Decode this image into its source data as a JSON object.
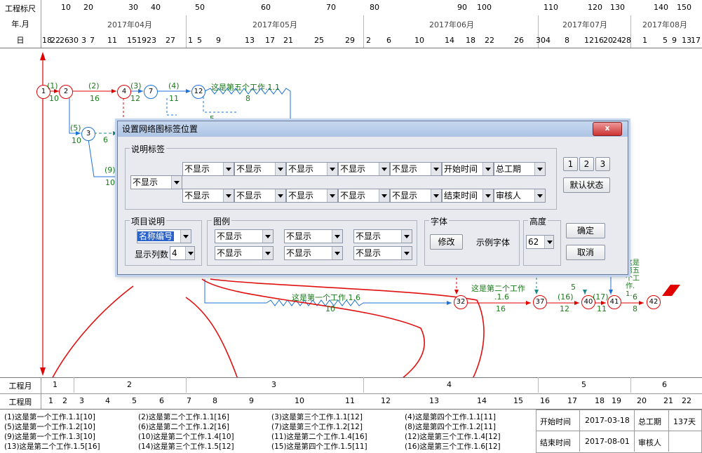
{
  "header": {
    "scale_label": "工程标尺",
    "month_label": "年.月",
    "day_label": "日",
    "scale_ticks": [
      "10",
      "20",
      "30",
      "40",
      "50",
      "60",
      "70",
      "80",
      "90",
      "100",
      "110",
      "120",
      "130",
      "140",
      "150"
    ],
    "months": [
      "2017年04月",
      "2017年05月",
      "2017年06月",
      "2017年07月",
      "2017年08月"
    ],
    "days": [
      "18",
      "22",
      "26",
      "30",
      "3",
      "7",
      "11",
      "15",
      "19",
      "23",
      "27",
      "1",
      "5",
      "9",
      "13",
      "17",
      "21",
      "25",
      "29",
      "2",
      "6",
      "10",
      "14",
      "18",
      "22",
      "26",
      "30",
      "4",
      "8",
      "12",
      "16",
      "20",
      "24",
      "28",
      "1",
      "5",
      "9",
      "13",
      "17"
    ]
  },
  "network": {
    "nodes": [
      "1",
      "2",
      "4",
      "7",
      "12",
      "3",
      "32",
      "37",
      "40",
      "41",
      "42"
    ],
    "labels": {
      "a1": "(1)",
      "d1": "10",
      "a2": "(2)",
      "d2": "16",
      "a3": "(3)",
      "d3": "12",
      "a4": "(4)",
      "d4": "11",
      "w5": "这是第五个工作.1.1",
      "d5": "8",
      "a5": "(5)",
      "d5b": "10",
      "d6": "6",
      "a9": "(9)",
      "d9": "10",
      "w5b": "5",
      "w_first": "这是第一个工作.1.6",
      "d_first": "10",
      "w_second": "这是第二个工作",
      "w_second2": ".1.6",
      "d32": "16",
      "a16": "(16)",
      "d37": "12",
      "w5c": "5",
      "a17": "(17)",
      "d40": "11",
      "d41": "6",
      "d41b": "8",
      "w5v": "这是第五个工作.1."
    }
  },
  "dialog": {
    "title": "设置网络图标签位置",
    "close": "x",
    "explain_group": "说明标签",
    "row1": [
      "不显示",
      "不显示",
      "不显示",
      "不显示",
      "不显示",
      "开始时间",
      "总工期"
    ],
    "row_mid": "不显示",
    "row2": [
      "不显示",
      "不显示",
      "不显示",
      "不显示",
      "不显示",
      "结束时间",
      "审核人"
    ],
    "pos_buttons": [
      "1",
      "2",
      "3"
    ],
    "default_btn": "默认状态",
    "project_group": "项目说明",
    "project_select": "名称编号",
    "cols_label": "显示列数",
    "cols_value": "4",
    "legend_group": "图例",
    "legend_row1": [
      "不显示",
      "不显示",
      "不显示"
    ],
    "legend_row2": [
      "不显示",
      "不显示",
      "不显示"
    ],
    "font_group": "字体",
    "font_btn": "修改",
    "font_sample": "示例字体",
    "height_group": "高度",
    "height_value": "62",
    "ok": "确定",
    "cancel": "取消"
  },
  "footer": {
    "month_label": "工程月",
    "months": [
      "1",
      "2",
      "3",
      "4",
      "5",
      "6"
    ],
    "week_label": "工程周",
    "weeks": [
      "1",
      "2",
      "3",
      "4",
      "5",
      "6",
      "7",
      "8",
      "9",
      "10",
      "11",
      "12",
      "13",
      "14",
      "15",
      "16",
      "17",
      "18",
      "19",
      "20",
      "21",
      "22"
    ],
    "legend_col1": [
      "(1)这是第一个工作.1.1[10]",
      "(5)这是第一个工作.1.2[10]",
      "(9)这是第一个工作.1.3[10]",
      "(13)这是第二个工作.1.5[16]"
    ],
    "legend_col2": [
      "(2)这是第二个工作.1.1[16]",
      "(6)这是第二个工作.1.2[16]",
      "(10)这是第二个工作.1.4[10]",
      "(14)这是第三个工作.1.5[12]"
    ],
    "legend_col3": [
      "(3)这是第三个工作.1.1[12]",
      "(7)这是第三个工作.1.2[12]",
      "(11)这是第二个工作.1.4[16]",
      "(15)这是第四个工作.1.5[11]"
    ],
    "legend_col4": [
      "(4)这是第四个工作.1.1[11]",
      "(8)这是第四个工作.1.2[11]",
      "(12)这是第三个工作.1.4[12]",
      "(16)这是第三个工作.1.6[12]"
    ],
    "summary": {
      "start_label": "开始时间",
      "start_value": "2017-03-18",
      "total_label": "总工期",
      "total_value": "137天",
      "end_label": "结束时间",
      "end_value": "2017-08-01",
      "review_label": "审核人",
      "review_value": ""
    }
  },
  "colors": {
    "critical": "#e00000",
    "normal": "#1e73d6",
    "label_green": "#1a7a1a",
    "annotation": "#e01010"
  }
}
